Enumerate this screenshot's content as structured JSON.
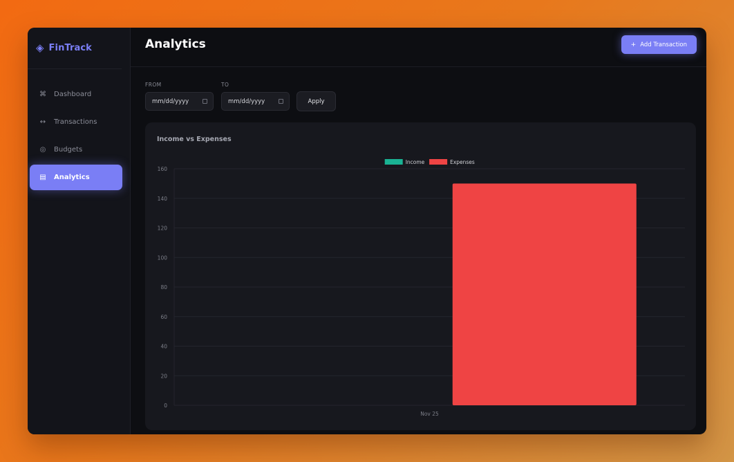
{
  "sidebar": {
    "brand": {
      "name": "FinTrack",
      "icon": "diamond-icon"
    },
    "items": [
      {
        "label": "Dashboard",
        "icon": "command-icon",
        "glyph": "⌘",
        "active": false
      },
      {
        "label": "Transactions",
        "icon": "arrows-icon",
        "glyph": "↔",
        "active": false
      },
      {
        "label": "Budgets",
        "icon": "target-icon",
        "glyph": "◎",
        "active": false
      },
      {
        "label": "Analytics",
        "icon": "chart-icon",
        "glyph": "▤",
        "active": true
      }
    ]
  },
  "header": {
    "title": "Analytics",
    "add_button": {
      "plus": "+",
      "label": "Add Transaction"
    }
  },
  "filters": {
    "from": {
      "label": "FROM",
      "placeholder": "mm/dd/yyyy"
    },
    "to": {
      "label": "TO",
      "placeholder": "mm/dd/yyyy"
    },
    "apply_label": "Apply"
  },
  "colors": {
    "accent": "#7a7ef5",
    "income": "#1ab394",
    "expenses": "#ef4444"
  },
  "card": {
    "title": "Income vs Expenses"
  },
  "chart_data": {
    "type": "bar",
    "categories": [
      "Nov 25"
    ],
    "series": [
      {
        "name": "Income",
        "values": [
          0
        ],
        "color": "#1ab394"
      },
      {
        "name": "Expenses",
        "values": [
          150
        ],
        "color": "#ef4444"
      }
    ],
    "ylim": [
      0,
      160
    ],
    "yticks": [
      0,
      20,
      40,
      60,
      80,
      100,
      120,
      140,
      160
    ],
    "grid": true,
    "legend": "top-center"
  }
}
